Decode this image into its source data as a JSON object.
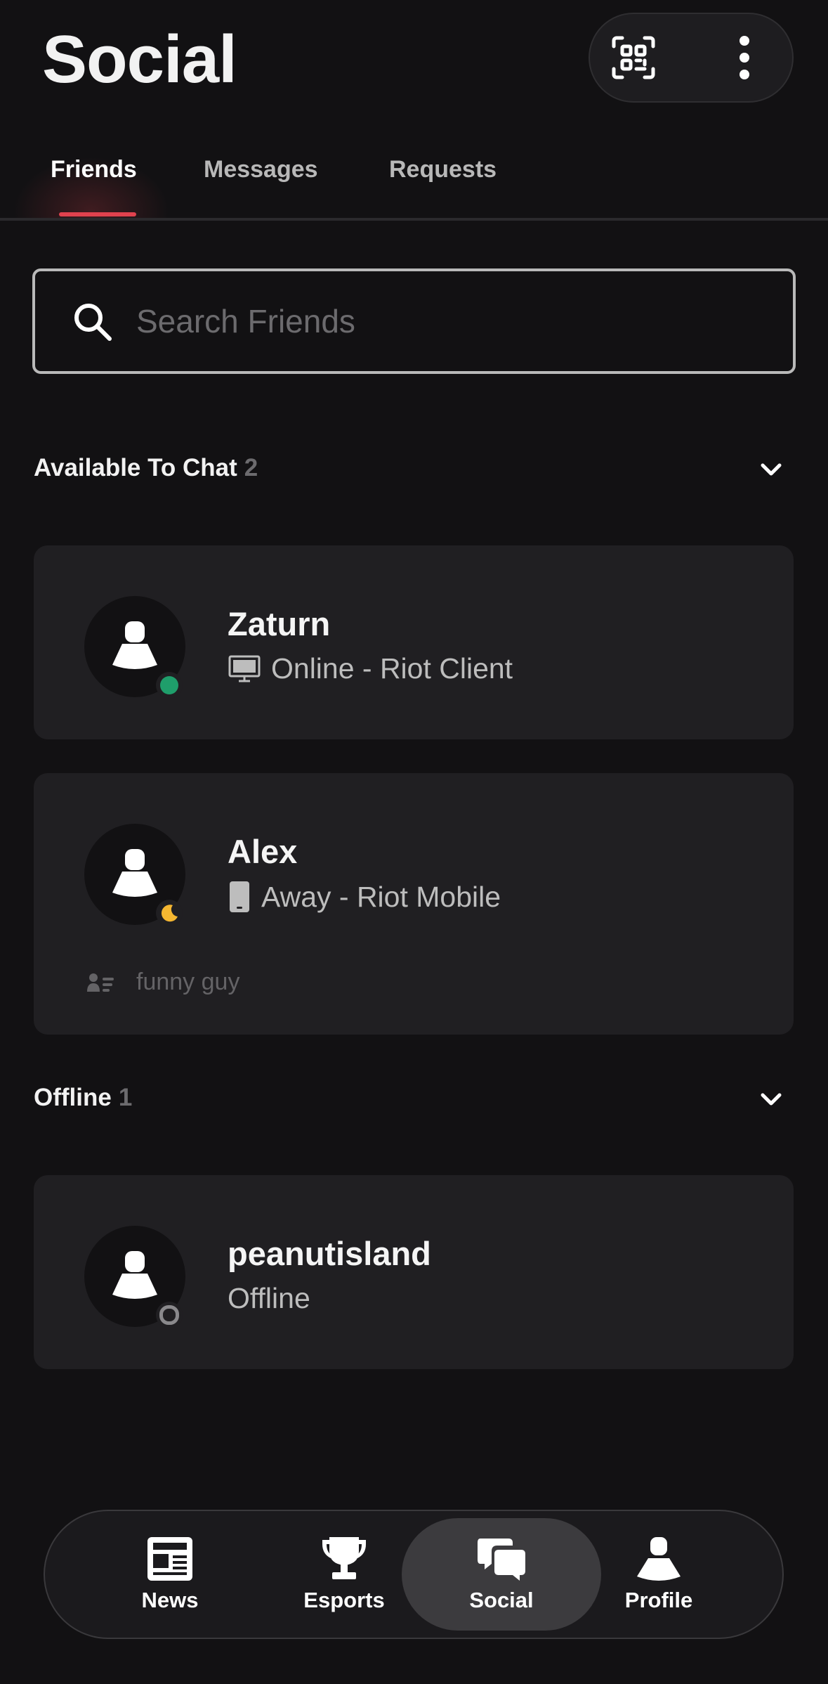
{
  "header": {
    "title": "Social",
    "actions": [
      {
        "icon": "qr-code-icon"
      },
      {
        "icon": "more-vertical-icon"
      }
    ]
  },
  "tabs": [
    {
      "label": "Friends",
      "active": true
    },
    {
      "label": "Messages",
      "active": false
    },
    {
      "label": "Requests",
      "active": false
    }
  ],
  "search": {
    "placeholder": "Search Friends",
    "value": ""
  },
  "sections": [
    {
      "label": "Available To Chat",
      "count": "2",
      "friends": [
        {
          "name": "Zaturn",
          "status": "Online - Riot Client",
          "device_icon": "desktop-icon",
          "status_color": "#1f9e6b"
        },
        {
          "name": "Alex",
          "status": "Away - Riot Mobile",
          "device_icon": "phone-icon",
          "status_icon": "moon-icon",
          "status_color": "#f5b731",
          "note": "funny guy"
        }
      ]
    },
    {
      "label": "Offline",
      "count": "1",
      "friends": [
        {
          "name": "peanutisland",
          "status": "Offline",
          "status_color": "#8a898c"
        }
      ]
    }
  ],
  "bottom_nav": [
    {
      "label": "News",
      "icon": "news-icon",
      "active": false
    },
    {
      "label": "Esports",
      "icon": "trophy-icon",
      "active": false
    },
    {
      "label": "Social",
      "icon": "chat-bubbles-icon",
      "active": true
    },
    {
      "label": "Profile",
      "icon": "profile-icon",
      "active": false
    }
  ],
  "colors": {
    "background": "#121113",
    "card": "#201f22",
    "accent": "#e0424e",
    "online": "#1f9e6b",
    "away": "#f5b731"
  }
}
